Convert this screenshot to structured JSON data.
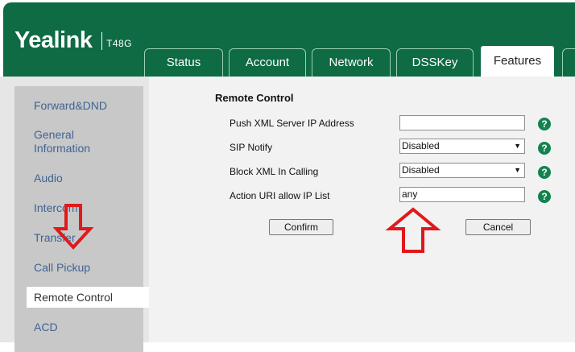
{
  "header": {
    "brand": "Yealink",
    "model": "T48G",
    "tabs": [
      {
        "label": "Status"
      },
      {
        "label": "Account"
      },
      {
        "label": "Network"
      },
      {
        "label": "DSSKey"
      },
      {
        "label": "Features",
        "active": true
      }
    ]
  },
  "sidebar": {
    "items": [
      {
        "label": "Forward&DND"
      },
      {
        "label": "General Information"
      },
      {
        "label": "Audio"
      },
      {
        "label": "Intercom"
      },
      {
        "label": "Transfer"
      },
      {
        "label": "Call Pickup"
      },
      {
        "label": "Remote Control",
        "active": true
      },
      {
        "label": "ACD"
      }
    ]
  },
  "main": {
    "section_title": "Remote Control",
    "fields": [
      {
        "label": "Push XML Server IP Address",
        "value": ""
      },
      {
        "label": "SIP Notify",
        "value": "Disabled"
      },
      {
        "label": "Block XML In Calling",
        "value": "Disabled"
      },
      {
        "label": "Action URI allow IP List",
        "value": "any"
      }
    ],
    "help_glyph": "?",
    "confirm_label": "Confirm",
    "cancel_label": "Cancel"
  },
  "colors": {
    "brand_green": "#0e6b44",
    "annotation_red": "#e0191b",
    "link_blue": "#3e6394"
  },
  "annotations": [
    "arrow-down-red",
    "arrow-up-red"
  ]
}
